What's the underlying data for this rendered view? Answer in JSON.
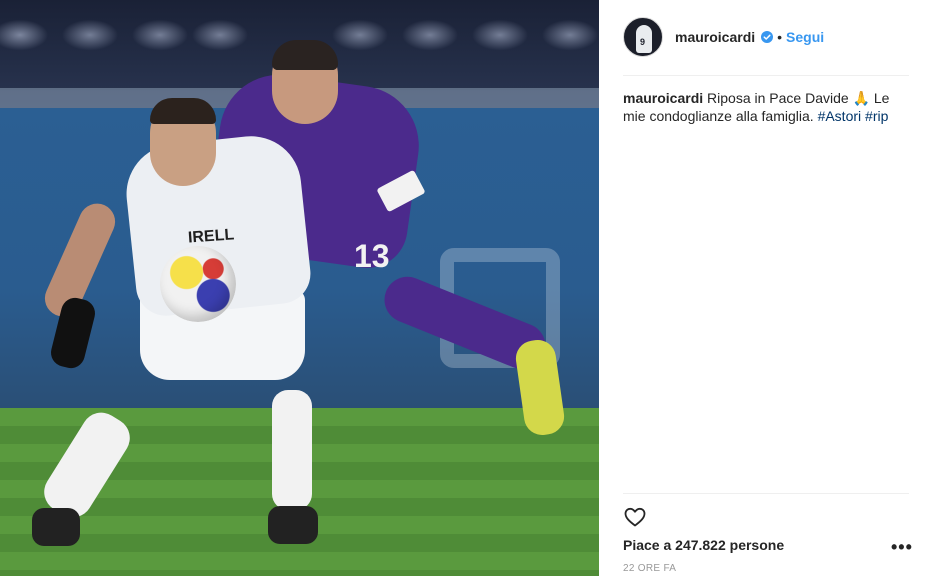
{
  "post": {
    "username": "mauroicardi",
    "follow_label": "Segui",
    "separator": "•",
    "caption": {
      "user": "mauroicardi",
      "text_before": "Riposa in Pace Davide",
      "emoji": "🙏",
      "text_after": "Le mie condoglianze alla famiglia.",
      "hashtags": [
        "#Astori",
        "#rip"
      ]
    },
    "likes_label": "Piace a 247.822 persone",
    "timestamp": "22 ORE FA",
    "more_label": "•••",
    "photo": {
      "number": "13",
      "sponsor": "IRELL",
      "avatar_number": "9"
    }
  },
  "colors": {
    "accent": "#3897f0",
    "hashtag": "#003569",
    "timestamp": "#999999",
    "divider": "#efefef"
  },
  "icons": [
    "verified-badge-icon",
    "heart-icon",
    "more-options-icon"
  ]
}
